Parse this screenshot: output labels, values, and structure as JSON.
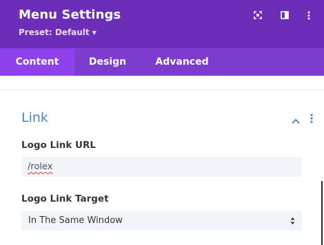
{
  "colors": {
    "header_bg": "#6c2eb9",
    "tabs_bg": "#7e3bd0",
    "active_tab_bg": "#8f42ec",
    "section_title": "#3e85d6",
    "field_bg": "#f1f5f9"
  },
  "header": {
    "title": "Menu Settings",
    "preset_label": "Preset: Default",
    "icons": [
      "expand-icon",
      "split-view-icon",
      "more-options-icon"
    ]
  },
  "tabs": [
    {
      "label": "Content",
      "active": true
    },
    {
      "label": "Design",
      "active": false
    },
    {
      "label": "Advanced",
      "active": false
    }
  ],
  "section": {
    "title": "Link",
    "expanded": true,
    "fields": {
      "logo_link_url": {
        "label": "Logo Link URL",
        "value": "/rolex"
      },
      "logo_link_target": {
        "label": "Logo Link Target",
        "selected": "In The Same Window"
      }
    }
  }
}
